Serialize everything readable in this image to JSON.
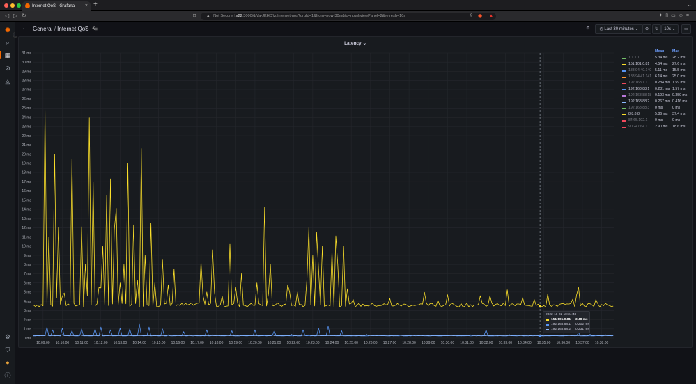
{
  "browser": {
    "tab_title": "Internet QoS - Grafana",
    "tab_close": "×",
    "new_tab": "+",
    "url_warning": "Not Secure",
    "url_host": "x22",
    "url_rest": ":3000/d/Va-JKHD7z/internet-qos?orgId=1&from=now-30m&to=now&viewPanel=2&refresh=10s",
    "menu": "⌄"
  },
  "topbar": {
    "crumb_parent": "General",
    "crumb_sep": " / ",
    "crumb_title": "Internet QoS",
    "time_range": "Last 30 minutes",
    "refresh_interval": "10s"
  },
  "panel": {
    "title": "Latency",
    "title_caret": "⌄"
  },
  "legend": {
    "mean_header": "Mean",
    "max_header": "Max",
    "rows": [
      {
        "name": "1.1.1.1",
        "color": "#73bf69",
        "mean": "5.34 ms",
        "max": "28.2 ms",
        "dim": true
      },
      {
        "name": "151.101.0.81",
        "color": "#fade2a",
        "mean": "4.54 ms",
        "max": "27.6 ms",
        "dim": false
      },
      {
        "name": "188.94.40.140",
        "color": "#5794f2",
        "mean": "5.11 ms",
        "max": "15.5 ms",
        "dim": true
      },
      {
        "name": "188.94.41.141",
        "color": "#ff9830",
        "mean": "6.14 ms",
        "max": "25.0 ms",
        "dim": true
      },
      {
        "name": "192.168.1.1",
        "color": "#f2495c",
        "mean": "0.284 ms",
        "max": "1.59 ms",
        "dim": true
      },
      {
        "name": "192.168.88.1",
        "color": "#5794f2",
        "mean": "0.281 ms",
        "max": "1.57 ms",
        "dim": false
      },
      {
        "name": "192.168.88.18",
        "color": "#b877d9",
        "mean": "0.193 ms",
        "max": "0.359 ms",
        "dim": true
      },
      {
        "name": "192.168.88.2",
        "color": "#8ab8ff",
        "mean": "0.267 ms",
        "max": "0.416 ms",
        "dim": false
      },
      {
        "name": "192.168.88.3",
        "color": "#73bf69",
        "mean": "0 ms",
        "max": "0 ms",
        "dim": true
      },
      {
        "name": "8.8.8.8",
        "color": "#fade2a",
        "mean": "5.86 ms",
        "max": "37.4 ms",
        "dim": false
      },
      {
        "name": "84.65.192.1",
        "color": "#f2495c",
        "mean": "0 ms",
        "max": "0 ms",
        "dim": true
      },
      {
        "name": "90.247.64.1",
        "color": "#f2495c",
        "mean": "2.90 ms",
        "max": "18.6 ms",
        "dim": true
      }
    ]
  },
  "tooltip": {
    "time": "2022-11-22 10:34:48",
    "rows": [
      {
        "name": "151.101.0.81",
        "value": "3.48 ms",
        "color": "#fade2a",
        "bold": true
      },
      {
        "name": "192.168.88.1",
        "value": "0.202 ms",
        "color": "#5794f2",
        "bold": false
      },
      {
        "name": "192.168.88.2",
        "value": "0.231 ms",
        "color": "#8ab8ff",
        "bold": false
      }
    ]
  },
  "chart_data": {
    "type": "line",
    "title": "Latency",
    "ylim": [
      0,
      31
    ],
    "y_ticks": [
      "0 ms",
      "1 ms",
      "2 ms",
      "3 ms",
      "4 ms",
      "5 ms",
      "6 ms",
      "7 ms",
      "8 ms",
      "9 ms",
      "10 ms",
      "11 ms",
      "12 ms",
      "13 ms",
      "14 ms",
      "15 ms",
      "16 ms",
      "17 ms",
      "18 ms",
      "19 ms",
      "20 ms",
      "21 ms",
      "22 ms",
      "23 ms",
      "24 ms",
      "25 ms",
      "26 ms",
      "27 ms",
      "28 ms",
      "29 ms",
      "30 ms",
      "31 ms"
    ],
    "x_ticks": [
      "10:09:00",
      "10:10:00",
      "10:11:00",
      "10:12:00",
      "10:13:00",
      "10:14:00",
      "10:15:00",
      "10:16:00",
      "10:17:00",
      "10:18:00",
      "10:19:00",
      "10:20:00",
      "10:21:00",
      "10:22:00",
      "10:23:00",
      "10:24:00",
      "10:25:00",
      "10:26:00",
      "10:27:00",
      "10:28:00",
      "10:29:00",
      "10:30:00",
      "10:31:00",
      "10:32:00",
      "10:33:00",
      "10:34:00",
      "10:35:00",
      "10:36:00",
      "10:37:00",
      "10:38:00"
    ],
    "x_start": "10:08:30",
    "x_end": "10:38:40",
    "hover_time": "10:34:48",
    "grid": true,
    "legend_placement": "right",
    "series": [
      {
        "name": "151.101.0.81",
        "color": "#fade2a",
        "baseline": 3.6,
        "spikes": [
          [
            "10:09:05",
            24.9
          ],
          [
            "10:09:20",
            11.0
          ],
          [
            "10:09:35",
            20.0
          ],
          [
            "10:09:50",
            12.0
          ],
          [
            "10:10:05",
            4.9
          ],
          [
            "10:10:15",
            27.6
          ],
          [
            "10:10:30",
            19.5
          ],
          [
            "10:10:45",
            6.0
          ],
          [
            "10:11:00",
            12.1
          ],
          [
            "10:11:10",
            8.0
          ],
          [
            "10:11:25",
            24.0
          ],
          [
            "10:11:35",
            17.0
          ],
          [
            "10:11:45",
            10.6
          ],
          [
            "10:11:55",
            5.5
          ],
          [
            "10:12:05",
            10.0
          ],
          [
            "10:12:20",
            15.5
          ],
          [
            "10:12:30",
            17.3
          ],
          [
            "10:12:40",
            11.8
          ],
          [
            "10:12:50",
            14.1
          ],
          [
            "10:13:00",
            6.0
          ],
          [
            "10:13:10",
            8.0
          ],
          [
            "10:13:25",
            19.0
          ],
          [
            "10:13:40",
            12.3
          ],
          [
            "10:13:55",
            6.3
          ],
          [
            "10:14:05",
            20.6
          ],
          [
            "10:14:20",
            9.0
          ],
          [
            "10:14:35",
            12.5
          ],
          [
            "10:14:50",
            6.0
          ],
          [
            "10:15:10",
            8.5
          ],
          [
            "10:15:30",
            5.8
          ],
          [
            "10:15:50",
            7.5
          ],
          [
            "10:16:15",
            4.5
          ],
          [
            "10:16:45",
            6.5
          ],
          [
            "10:17:10",
            8.3
          ],
          [
            "10:17:30",
            5.0
          ],
          [
            "10:17:50",
            9.6
          ],
          [
            "10:18:15",
            7.0
          ],
          [
            "10:18:40",
            10.2
          ],
          [
            "10:19:00",
            5.5
          ],
          [
            "10:19:20",
            7.0
          ],
          [
            "10:19:45",
            11.0
          ],
          [
            "10:20:05",
            6.0
          ],
          [
            "10:20:15",
            18.0
          ],
          [
            "10:20:30",
            14.2
          ],
          [
            "10:20:50",
            8.0
          ],
          [
            "10:21:15",
            6.2
          ],
          [
            "10:21:40",
            5.8
          ],
          [
            "10:22:10",
            5.0
          ],
          [
            "10:22:40",
            6.5
          ],
          [
            "10:22:50",
            12.0
          ],
          [
            "10:23:00",
            9.0
          ],
          [
            "10:23:10",
            11.5
          ],
          [
            "10:23:20",
            7.5
          ],
          [
            "10:23:30",
            10.0
          ],
          [
            "10:23:45",
            12.5
          ],
          [
            "10:24:00",
            9.5
          ],
          [
            "10:24:10",
            11.1
          ],
          [
            "10:24:20",
            8.0
          ],
          [
            "10:24:35",
            10.0
          ],
          [
            "10:24:45",
            6.0
          ],
          [
            "10:25:05",
            4.2
          ],
          [
            "10:27:00",
            4.3
          ],
          [
            "10:29:30",
            4.1
          ],
          [
            "10:32:10",
            4.6
          ],
          [
            "10:34:30",
            4.2
          ],
          [
            "10:36:50",
            5.5
          ],
          [
            "10:37:40",
            4.2
          ]
        ]
      },
      {
        "name": "192.168.88.1",
        "color": "#5794f2",
        "baseline": 0.25,
        "spikes": [
          [
            "10:09:10",
            1.2
          ],
          [
            "10:09:30",
            0.9
          ],
          [
            "10:10:00",
            1.1
          ],
          [
            "10:10:30",
            0.8
          ],
          [
            "10:11:00",
            1.0
          ],
          [
            "10:11:40",
            1.0
          ],
          [
            "10:12:00",
            1.2
          ],
          [
            "10:12:30",
            0.9
          ],
          [
            "10:13:00",
            1.1
          ],
          [
            "10:13:30",
            1.0
          ],
          [
            "10:14:00",
            1.5
          ],
          [
            "10:14:30",
            1.2
          ],
          [
            "10:15:10",
            1.0
          ],
          [
            "10:16:20",
            0.7
          ],
          [
            "10:17:30",
            0.9
          ],
          [
            "10:18:50",
            0.8
          ],
          [
            "10:20:00",
            0.9
          ],
          [
            "10:21:00",
            0.8
          ],
          [
            "10:22:30",
            0.9
          ],
          [
            "10:23:20",
            1.1
          ],
          [
            "10:23:50",
            1.3
          ],
          [
            "10:24:30",
            0.8
          ],
          [
            "10:32:00",
            0.9
          ],
          [
            "10:36:50",
            0.6
          ]
        ]
      },
      {
        "name": "192.168.88.2",
        "color": "#8ab8ff",
        "baseline": 0.27,
        "spikes": []
      }
    ]
  }
}
